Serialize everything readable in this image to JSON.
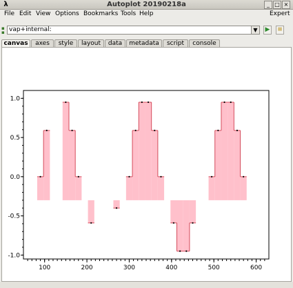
{
  "window": {
    "title": "Autoplot 20190218a",
    "app_icon": "λ"
  },
  "menubar": {
    "file": "File",
    "edit": "Edit",
    "view": "View",
    "options": "Options",
    "bookmarks": "Bookmarks",
    "tools": "Tools",
    "help": "Help",
    "expert": "Expert"
  },
  "address": {
    "value": "vap+internal:",
    "dropdown_icon": "▼",
    "go_icon": "▶",
    "bookmark_icon": "≡"
  },
  "tabs": {
    "canvas": "canvas",
    "axes": "axes",
    "style": "style",
    "layout": "layout",
    "data": "data",
    "metadata": "metadata",
    "script": "script",
    "console": "console"
  },
  "colors": {
    "fill": "#ffc0cb",
    "line": "#d44b5b",
    "marker": "#000000"
  },
  "chart_data": {
    "type": "area",
    "style": "stair-step fill to reference level",
    "reference": -0.3,
    "x": [
      90,
      105,
      120,
      135,
      150,
      165,
      180,
      195,
      210,
      225,
      240,
      255,
      270,
      285,
      300,
      315,
      330,
      345,
      360,
      375,
      390,
      405,
      420,
      435,
      450,
      465,
      480,
      495,
      510,
      525,
      540,
      555,
      570,
      585,
      600
    ],
    "y": [
      0.0,
      0.59,
      null,
      null,
      0.95,
      0.59,
      0.0,
      null,
      -0.59,
      null,
      null,
      null,
      -0.4,
      null,
      0.0,
      0.59,
      0.95,
      0.95,
      0.59,
      0.0,
      null,
      -0.59,
      -0.95,
      -0.95,
      -0.59,
      null,
      null,
      0.0,
      0.59,
      0.95,
      0.95,
      0.59,
      0.0,
      null,
      null
    ],
    "xlim": [
      50,
      630
    ],
    "ylim": [
      -1.05,
      1.1
    ],
    "x_ticks": [
      "100",
      "200",
      "300",
      "400",
      "500",
      "600"
    ],
    "y_ticks": [
      "1.0",
      "0.5",
      "0.0",
      "-0.5",
      "-1.0"
    ],
    "grid": false
  }
}
